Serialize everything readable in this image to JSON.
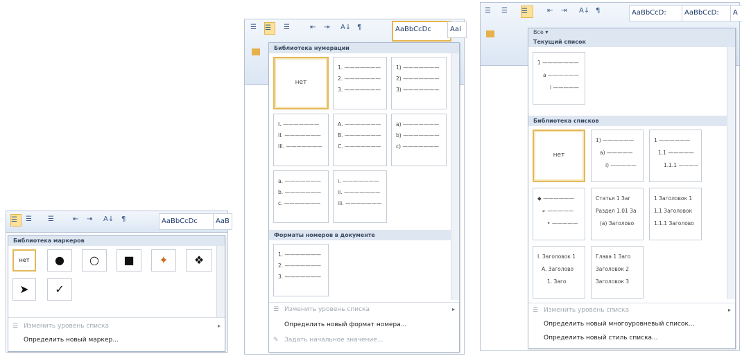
{
  "p1": {
    "ribbon": {
      "buttons": [
        "☰",
        "☰",
        "☰",
        "⇤",
        "⇥",
        "A↓",
        "¶"
      ],
      "style_preview": "AaBbCcDc",
      "style_partial": "AaB"
    },
    "header": "Библиотека маркеров",
    "symbols": [
      "нет",
      "●",
      "○",
      "■",
      "✦",
      "❖",
      "➤",
      "✓"
    ],
    "commands": [
      "Изменить уровень списка",
      "Определить новый маркер..."
    ]
  },
  "p2": {
    "ribbon": {
      "buttons": [
        "☰",
        "☰",
        "☰",
        "⇤",
        "⇥",
        "A↓",
        "¶"
      ],
      "style_preview": "AaBbCcDc",
      "style_partial": "AaI"
    },
    "header_library": "Библиотека нумерации",
    "none_label": "нет",
    "tiles": [
      [
        "1.",
        "2.",
        "3."
      ],
      [
        "1)",
        "2)",
        "3)"
      ],
      [
        "I.",
        "II.",
        "III."
      ],
      [
        "A.",
        "B.",
        "C."
      ],
      [
        "a)",
        "b)",
        "c)"
      ],
      [
        "a.",
        "b.",
        "c."
      ],
      [
        "i.",
        "ii.",
        "iii."
      ]
    ],
    "header_doc": "Форматы номеров в документе",
    "doc_tile": [
      "1.",
      "2.",
      "3."
    ],
    "commands": [
      "Изменить уровень списка",
      "Определить новый формат номера...",
      "Задать начальное значение..."
    ]
  },
  "p3": {
    "ribbon": {
      "buttons": [
        "☰",
        "☰",
        "☰",
        "⇤",
        "⇥",
        "A↓",
        "¶"
      ],
      "style_previews": [
        "AaBbCcD:",
        "AaBbCcD:",
        "A"
      ]
    },
    "filter_label": "Все ▾",
    "header_current": "Текущий список",
    "current_tile": [
      "1",
      "a",
      "i"
    ],
    "header_library": "Библиотека списков",
    "none_label": "нет",
    "tiles": [
      [
        "1)",
        "a)",
        "i)"
      ],
      [
        "1",
        "1.1",
        "1.1.1"
      ],
      [
        "◆",
        "➢",
        "•"
      ],
      [
        "Статья 1 Заг",
        "Раздел 1.01 За",
        "(a) Заголово"
      ],
      [
        "1 Заголовок 1",
        "1.1 Заголовок",
        "1.1.1 Заголово"
      ],
      [
        "I. Заголовок 1",
        "A. Заголово",
        "1. Заго"
      ],
      [
        "Глава 1 Заго",
        "Заголовок 2",
        "Заголовок 3"
      ]
    ],
    "commands": [
      "Изменить уровень списка",
      "Определить новый многоуровневый список...",
      "Определить новый стиль списка..."
    ]
  }
}
